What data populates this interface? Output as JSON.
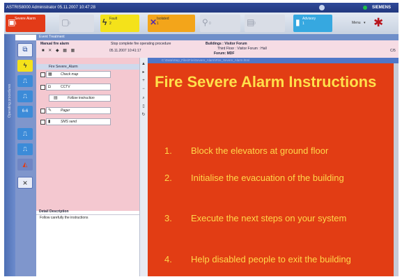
{
  "window": {
    "title": "ASTRIS8000  Administrator  05.11.2007 10:47:28",
    "brand": "SIEMENS"
  },
  "toolbar": {
    "severe_alarm": {
      "label": "Severe Alarm",
      "count": "1",
      "color": "#e33b18"
    },
    "alarm_2": {
      "label": "",
      "count": "0",
      "color": "#d9dde6"
    },
    "fault": {
      "label": "Fault",
      "count": "2",
      "color": "#f4e21a"
    },
    "isolated": {
      "label": "Isolated",
      "count": "1",
      "color": "#f3a51a"
    },
    "alarm_5": {
      "label": "",
      "count": "0",
      "color": "#d9dde6"
    },
    "alarm_6": {
      "label": "",
      "count": "0",
      "color": "#d9dde6"
    },
    "advisory": {
      "label": "Advisory",
      "count": "1",
      "color": "#36a8e0"
    },
    "menu": {
      "label": "Menu"
    }
  },
  "sidebar": {
    "vertical_label": "Operating procedures"
  },
  "header": {
    "section": "Event Treatment",
    "event_title": "Manual fire alarm",
    "instruction": "Stop complete fire operating procedure",
    "timestamp": "05.11.2007  10:41:17",
    "location_label": "Buildings : Visitor Forum",
    "location_detail": "Third Floor : Visitor Forum : Hall",
    "location_extra": "Forum: MDF",
    "right_code": "C/5"
  },
  "steps": {
    "header": "Fire Severe_Alarm",
    "items": [
      {
        "label": "Check map"
      },
      {
        "label": "CCTV"
      },
      {
        "label": "Follow instruction"
      },
      {
        "label": "Pager"
      },
      {
        "label": "SMS send"
      }
    ]
  },
  "detail": {
    "label": "Detail Description",
    "text": "Follow carefully the instructions"
  },
  "instructions": {
    "path": "C:\\Data\\Step_Files\\Fire\\Severe_Alarm\\Fire_Severe_Alarm.html",
    "title": "Fire Severe Alarm Instructions",
    "items": [
      {
        "number": "1.",
        "text": "Block the elevators at ground floor"
      },
      {
        "number": "2.",
        "text": "Initialise the evacuation of the building"
      },
      {
        "number": "3.",
        "text": "Execute the next steps on your system"
      },
      {
        "number": "4.",
        "text": "Help disabled people to exit the building"
      }
    ]
  }
}
